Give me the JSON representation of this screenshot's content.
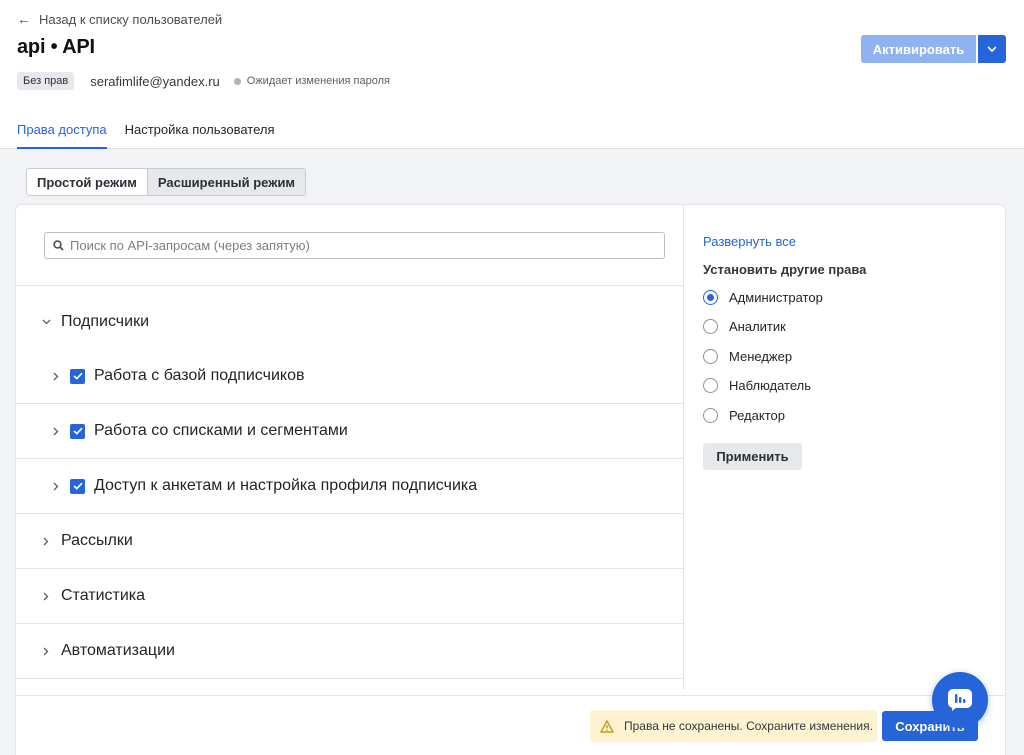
{
  "header": {
    "back_label": "Назад к списку пользователей",
    "title": "api • API",
    "badge": "Без прав",
    "email": "serafimlife@yandex.ru",
    "status": "Ожидает изменения пароля",
    "activate_label": "Активировать"
  },
  "tabs": [
    {
      "label": "Права доступа",
      "active": true
    },
    {
      "label": "Настройка пользователя",
      "active": false
    }
  ],
  "modes": [
    {
      "label": "Простой режим",
      "selected": false
    },
    {
      "label": "Расширенный режим",
      "selected": true
    }
  ],
  "search": {
    "placeholder": "Поиск по API-запросам (через запятую)",
    "value": ""
  },
  "tree": {
    "section_subscribers": "Подписчики",
    "sub_items": [
      {
        "label": "Работа с базой подписчиков",
        "checked": true
      },
      {
        "label": "Работа со списками и сегментами",
        "checked": true
      },
      {
        "label": "Доступ к анкетам и настройка профиля подписчика",
        "checked": true
      }
    ],
    "section_mailings": "Рассылки",
    "section_stats": "Статистика",
    "section_automations": "Автоматизации"
  },
  "side": {
    "expand_all": "Развернуть все",
    "set_other": "Установить другие права",
    "roles": [
      {
        "label": "Администратор",
        "checked": true
      },
      {
        "label": "Аналитик",
        "checked": false
      },
      {
        "label": "Менеджер",
        "checked": false
      },
      {
        "label": "Наблюдатель",
        "checked": false
      },
      {
        "label": "Редактор",
        "checked": false
      }
    ],
    "apply_label": "Применить"
  },
  "footer": {
    "warning": "Права не сохранены. Сохраните изменения.",
    "save_label": "Сохранить"
  },
  "colors": {
    "accent": "#2565d9",
    "accent_disabled": "#8fb2f0",
    "warning_bg": "#fdf3d1",
    "warning_icon": "#c99a1a"
  }
}
